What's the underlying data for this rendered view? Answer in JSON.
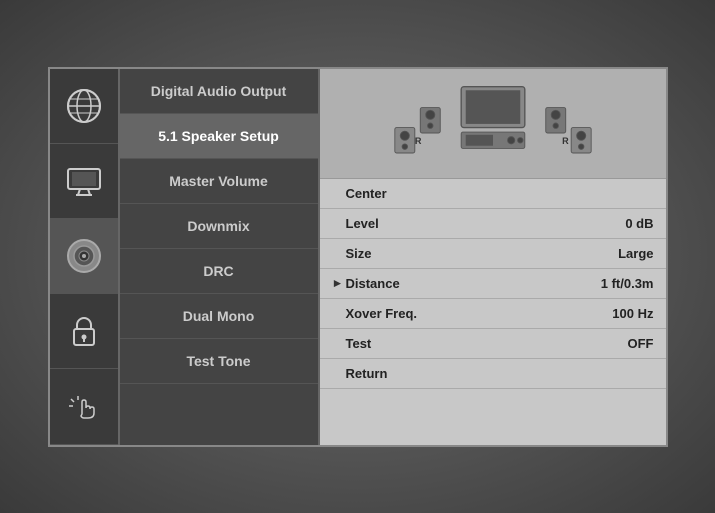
{
  "sidebar": {
    "items": [
      {
        "id": "globe",
        "label": "Internet/Network",
        "active": false
      },
      {
        "id": "display",
        "label": "Display",
        "active": false
      },
      {
        "id": "audio",
        "label": "Audio",
        "active": true
      },
      {
        "id": "lock",
        "label": "Parental Lock",
        "active": false
      },
      {
        "id": "touch",
        "label": "Touch/Interface",
        "active": false
      }
    ]
  },
  "menu": {
    "items": [
      {
        "id": "digital-audio-output",
        "label": "Digital Audio Output",
        "highlighted": false
      },
      {
        "id": "speaker-setup",
        "label": "5.1 Speaker Setup",
        "highlighted": true
      },
      {
        "id": "master-volume",
        "label": "Master Volume",
        "highlighted": false
      },
      {
        "id": "downmix",
        "label": "Downmix",
        "highlighted": false
      },
      {
        "id": "drc",
        "label": "DRC",
        "highlighted": false
      },
      {
        "id": "dual-mono",
        "label": "Dual Mono",
        "highlighted": false
      },
      {
        "id": "test-tone",
        "label": "Test Tone",
        "highlighted": false
      }
    ]
  },
  "detail": {
    "speaker_section": "Center",
    "rows": [
      {
        "id": "center",
        "label": "Center",
        "value": "",
        "has_arrow": false,
        "is_header": true
      },
      {
        "id": "level",
        "label": "Level",
        "value": "0 dB",
        "has_arrow": false
      },
      {
        "id": "size",
        "label": "Size",
        "value": "Large",
        "has_arrow": false
      },
      {
        "id": "distance",
        "label": "Distance",
        "value": "1 ft/0.3m",
        "has_arrow": true
      },
      {
        "id": "xover-freq",
        "label": "Xover Freq.",
        "value": "100 Hz",
        "has_arrow": false
      },
      {
        "id": "test",
        "label": "Test",
        "value": "OFF",
        "has_arrow": false
      },
      {
        "id": "return",
        "label": "Return",
        "value": "",
        "has_arrow": false
      }
    ]
  }
}
